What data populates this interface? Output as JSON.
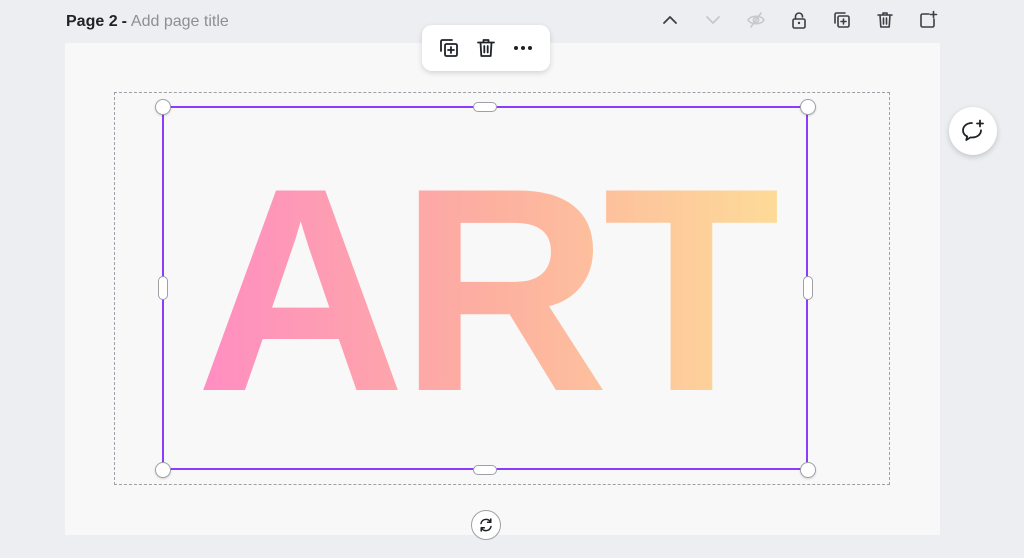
{
  "page_header": {
    "label": "Page 2",
    "separator": "-",
    "title_placeholder": "Add page title"
  },
  "page_actions": [
    {
      "name": "move-page-up",
      "icon": "chevron-up-icon",
      "enabled": true
    },
    {
      "name": "move-page-down",
      "icon": "chevron-down-icon",
      "enabled": false
    },
    {
      "name": "hide-page",
      "icon": "eye-off-icon",
      "enabled": false
    },
    {
      "name": "lock-page",
      "icon": "lock-icon",
      "enabled": true
    },
    {
      "name": "duplicate-page",
      "icon": "duplicate-icon",
      "enabled": true
    },
    {
      "name": "delete-page",
      "icon": "trash-icon",
      "enabled": true
    },
    {
      "name": "add-page",
      "icon": "add-page-icon",
      "enabled": true
    }
  ],
  "floating_toolbar": [
    {
      "name": "duplicate-element",
      "icon": "duplicate-icon"
    },
    {
      "name": "delete-element",
      "icon": "trash-icon"
    },
    {
      "name": "more-options",
      "icon": "more-horizontal-icon"
    }
  ],
  "canvas": {
    "text_element": "ART",
    "gradient_colors": [
      "#ff8dc2",
      "#fdb0a0",
      "#fddc98"
    ],
    "selection_color": "#8b3dff"
  },
  "comment_button": {
    "icon": "add-comment-icon"
  },
  "rotate_handle": {
    "icon": "rotate-icon"
  }
}
